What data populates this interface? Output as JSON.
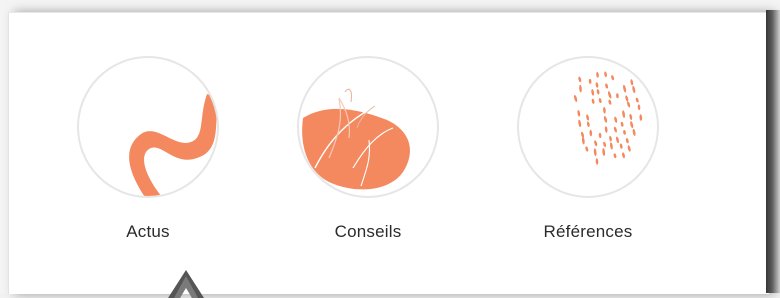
{
  "categories": [
    {
      "label": "Actus",
      "icon": "wave-icon"
    },
    {
      "label": "Conseils",
      "icon": "leaf-icon"
    },
    {
      "label": "Références",
      "icon": "dots-icon"
    }
  ],
  "colors": {
    "accent": "#f4895f",
    "circle_border": "#e6e6e6",
    "text": "#2b2b2b"
  },
  "cursor_icon": "pointer-arrow-icon"
}
